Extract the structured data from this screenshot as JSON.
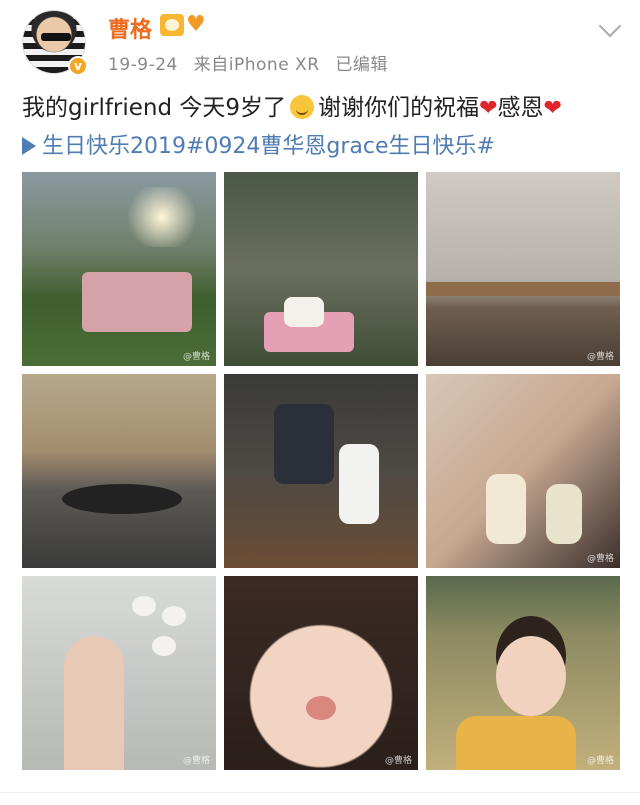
{
  "post": {
    "author": "曹格",
    "date": "19-9-24",
    "source": "来自iPhone XR",
    "status": "已编辑",
    "text_part1": "我的girlfriend 今天9岁了",
    "text_part2": "谢谢你们的祝福",
    "text_part3": "感恩",
    "topic": "生日快乐2019#0924曹华恩grace生日快乐#"
  },
  "photos": [
    {
      "watermark": "@曹格"
    },
    {
      "watermark": ""
    },
    {
      "watermark": "@曹格"
    },
    {
      "watermark": ""
    },
    {
      "watermark": ""
    },
    {
      "watermark": "@曹格"
    },
    {
      "watermark": "@曹格"
    },
    {
      "watermark": "@曹格"
    },
    {
      "watermark": "@曹格"
    }
  ],
  "colors": {
    "username": "#ee6b1f",
    "topic_link": "#4f7cb3",
    "heart": "#e0262b"
  }
}
